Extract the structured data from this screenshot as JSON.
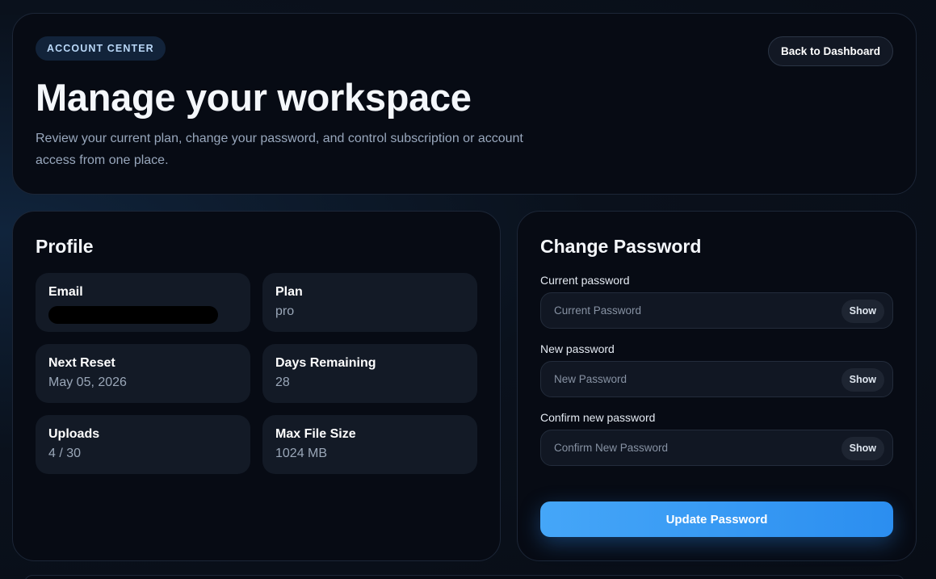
{
  "header": {
    "badge": "ACCOUNT CENTER",
    "back_label": "Back to Dashboard",
    "title": "Manage your workspace",
    "subtitle": "Review your current plan, change your password, and control subscription or account access from one place."
  },
  "profile": {
    "title": "Profile",
    "tiles": [
      {
        "label": "Email",
        "value": ""
      },
      {
        "label": "Plan",
        "value": "pro"
      },
      {
        "label": "Next Reset",
        "value": "May 05, 2026"
      },
      {
        "label": "Days Remaining",
        "value": "28"
      },
      {
        "label": "Uploads",
        "value": "4 / 30"
      },
      {
        "label": "Max File Size",
        "value": "1024 MB"
      }
    ]
  },
  "password": {
    "title": "Change Password",
    "fields": [
      {
        "label": "Current password",
        "placeholder": "Current Password",
        "toggle": "Show"
      },
      {
        "label": "New password",
        "placeholder": "New Password",
        "toggle": "Show"
      },
      {
        "label": "Confirm new password",
        "placeholder": "Confirm New Password",
        "toggle": "Show"
      }
    ],
    "submit_label": "Update Password"
  },
  "colors": {
    "accent": "#3b9cf5",
    "card_bg": "#070b14",
    "tile_bg": "#131a26"
  }
}
